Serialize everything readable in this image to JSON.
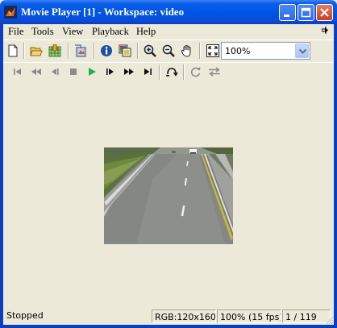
{
  "window": {
    "title": "Movie Player [1] - Workspace: video"
  },
  "menu": {
    "file": "File",
    "tools": "Tools",
    "view": "View",
    "playback": "Playback",
    "help": "Help"
  },
  "toolbar": {
    "zoom_value": "100%"
  },
  "status": {
    "state": "Stopped",
    "format": "RGB:120x160",
    "zoom_fps": "100% (15 fps)",
    "frame": "1 / 119"
  },
  "colors": {
    "titlebar": "#0054E3",
    "play_green": "#22B14C",
    "panel": "#ECE9D8"
  }
}
